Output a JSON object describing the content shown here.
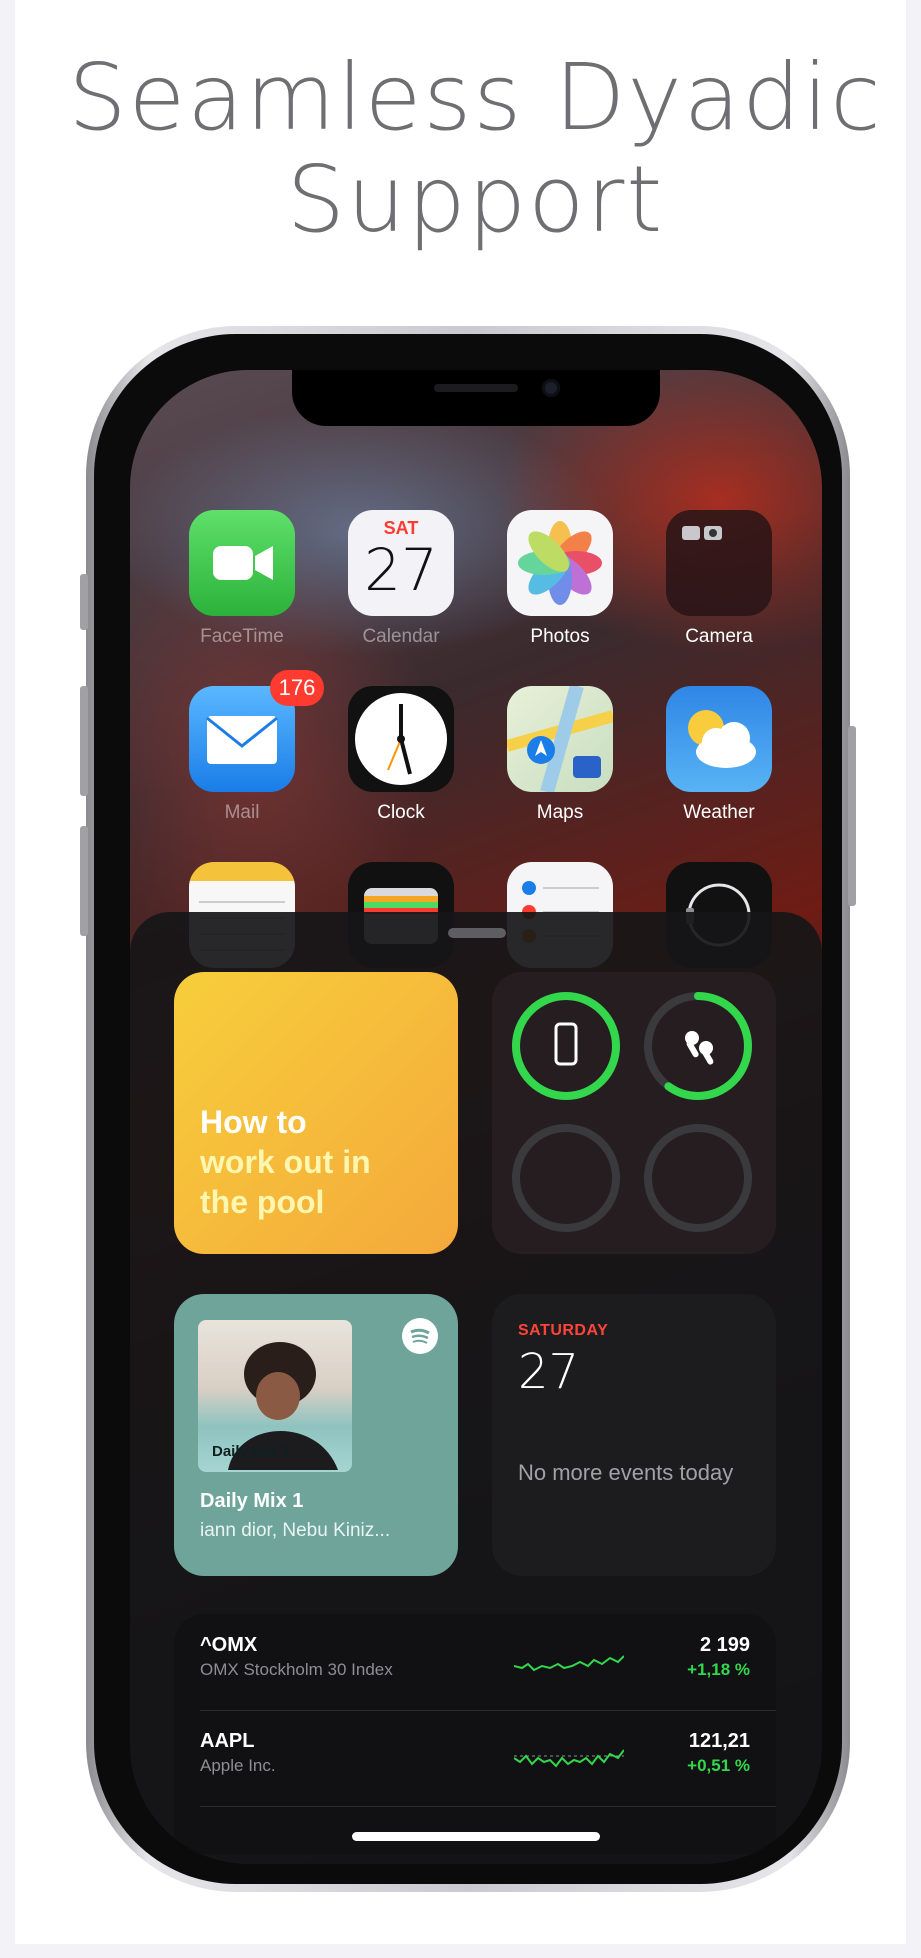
{
  "headline": {
    "line1": "Seamless Dyadic",
    "line2": "Support"
  },
  "home_screen": {
    "apps": [
      {
        "label": "FaceTime"
      },
      {
        "label": "Calendar",
        "day": "SAT",
        "date": "27"
      },
      {
        "label": "Photos"
      },
      {
        "label": "Camera"
      },
      {
        "label": "Mail",
        "badge": "176"
      },
      {
        "label": "Clock"
      },
      {
        "label": "Maps"
      },
      {
        "label": "Weather"
      }
    ]
  },
  "widgets": {
    "tips": {
      "line1": "How to",
      "line2": "work out in",
      "line3": "the pool"
    },
    "batteries": {
      "iphone_level": 1.0,
      "airpods_level": 0.6
    },
    "music": {
      "cover_title": "Daily Mix 1",
      "title": "Daily Mix 1",
      "artists": "iann dior, Nebu Kiniz..."
    },
    "calendar": {
      "day": "SATURDAY",
      "date": "27",
      "note": "No more events today"
    },
    "stocks": [
      {
        "symbol": "^OMX",
        "name": "OMX Stockholm 30 Index",
        "price": "2 199",
        "change": "+1,18 %"
      },
      {
        "symbol": "AAPL",
        "name": "Apple Inc.",
        "price": "121,21",
        "change": "+0,51 %"
      }
    ]
  },
  "colors": {
    "accent_green": "#32d74b",
    "calendar_red": "#ff453a",
    "tips_yellow": "#f7ce3b",
    "spotify_green": "#6ea49a"
  }
}
